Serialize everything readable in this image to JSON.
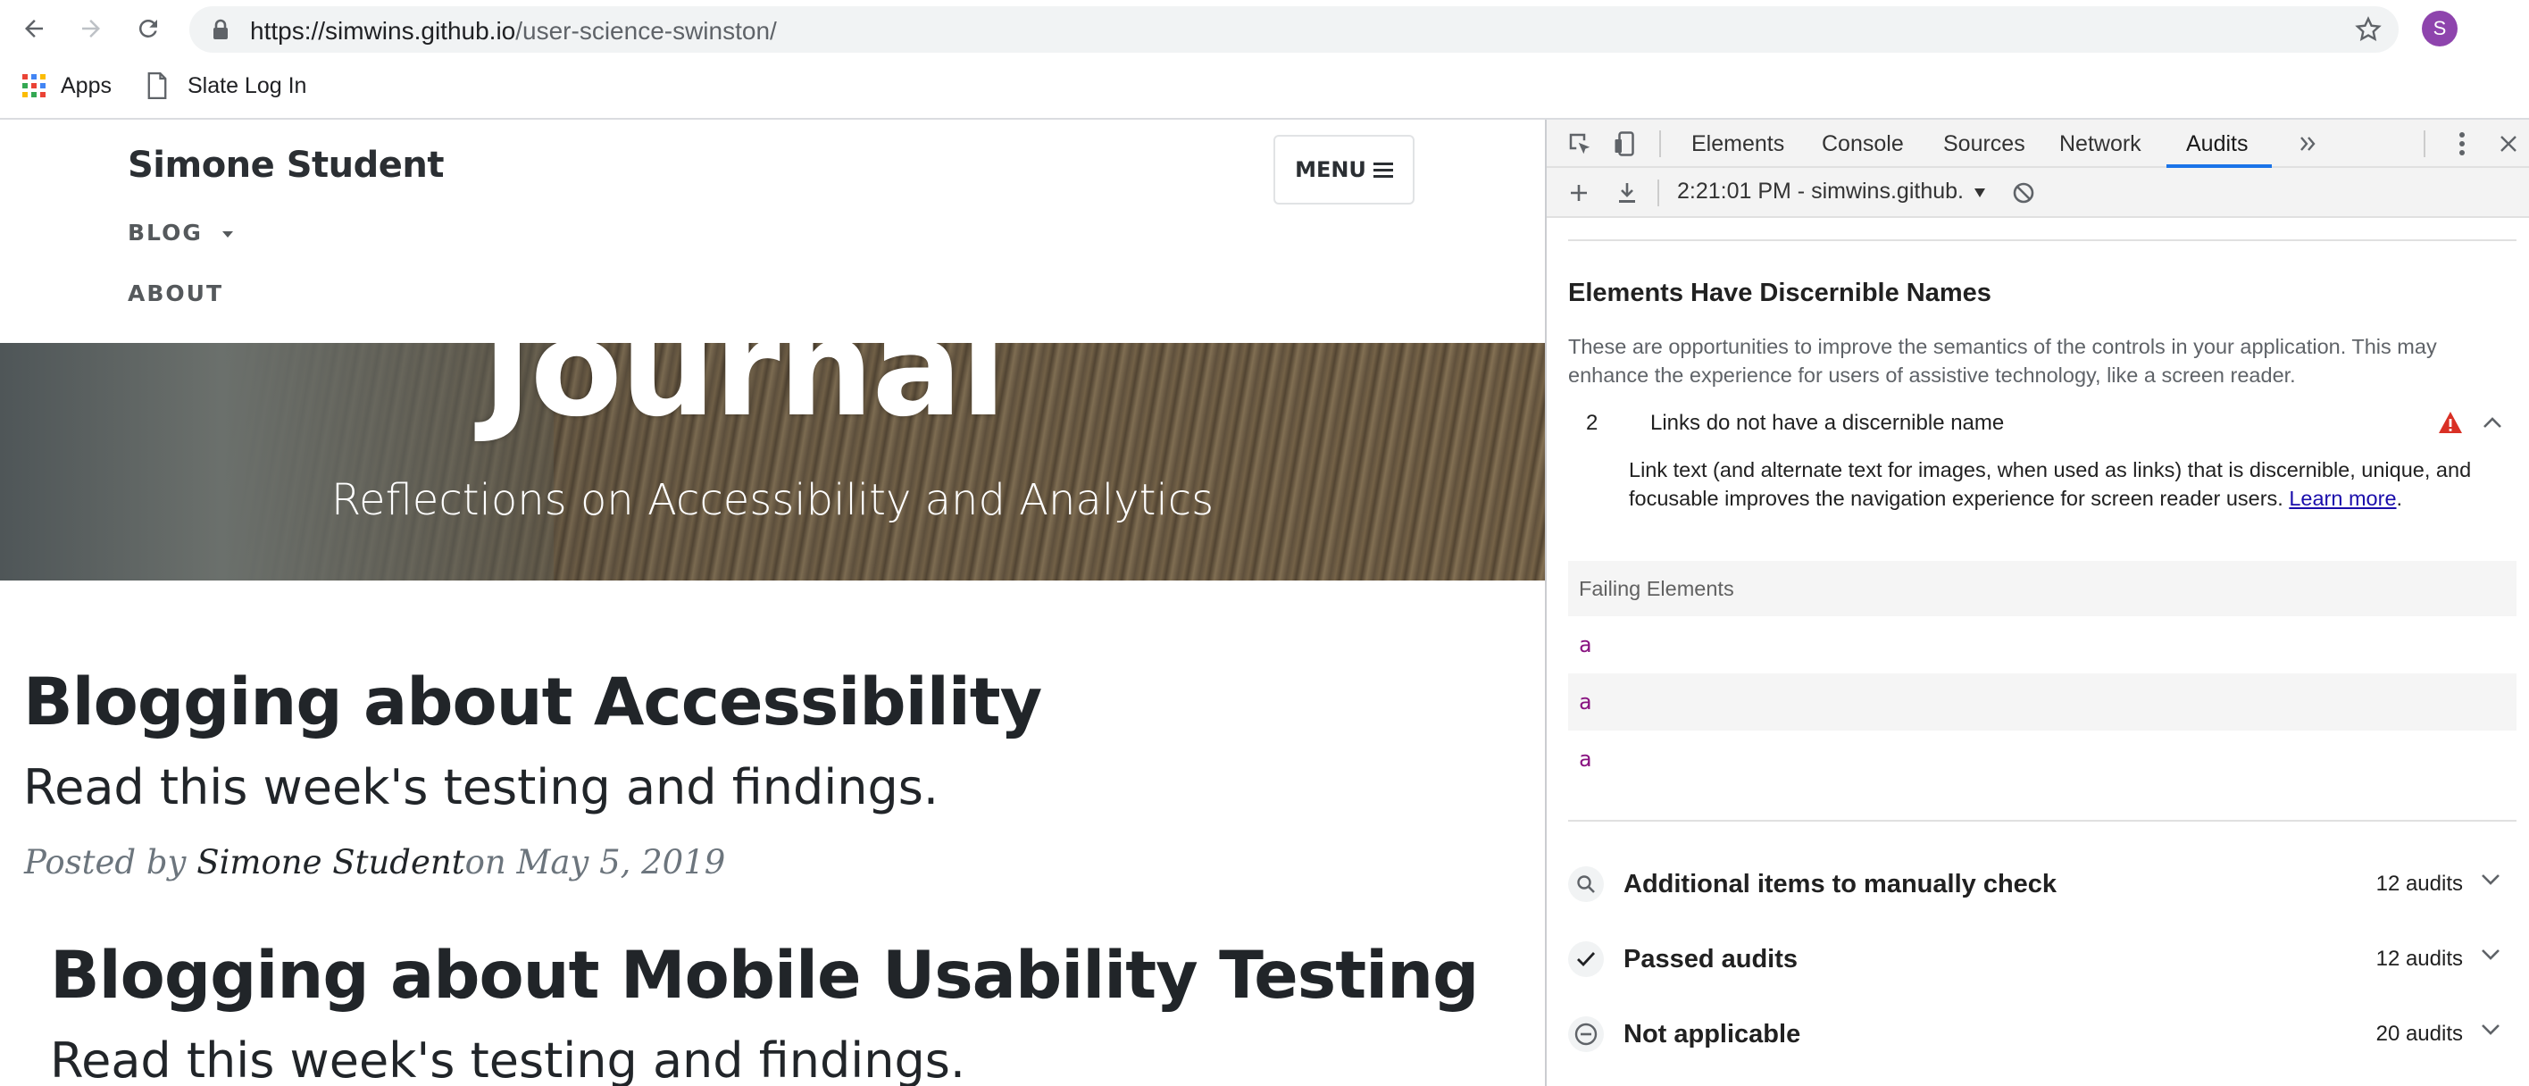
{
  "browser": {
    "url_host": "https://simwins.github.io",
    "url_path": "/user-science-swinston/",
    "profile_initial": "S",
    "bookmarks": [
      {
        "label": "Apps",
        "icon": "apps-grid-icon"
      },
      {
        "label": "Slate Log In",
        "icon": "document-icon"
      }
    ]
  },
  "page": {
    "site_title": "Simone Student",
    "menu_label": "MENU",
    "nav": [
      {
        "label": "BLOG"
      },
      {
        "label": "ABOUT"
      }
    ],
    "hero": {
      "title": "Journal",
      "subtitle": "Reflections on Accessibility and Analytics"
    },
    "posts": [
      {
        "title": "Blogging about Accessibility",
        "subtitle": "Read this week's testing and findings.",
        "meta_prefix": "Posted by ",
        "meta_author": "Simone Student",
        "meta_suffix": "on May 5, 2019"
      },
      {
        "title": "Blogging about Mobile Usability Testing",
        "subtitle": "Read this week's testing and findings."
      }
    ]
  },
  "devtools": {
    "tabs": [
      {
        "label": "Elements"
      },
      {
        "label": "Console"
      },
      {
        "label": "Sources"
      },
      {
        "label": "Network"
      },
      {
        "label": "Audits",
        "active": true
      }
    ],
    "report_label": "2:21:01 PM - simwins.github.io",
    "group": {
      "title": "Elements Have Discernible Names",
      "description": "These are opportunities to improve the semantics of the controls in your application. This may enhance the experience for users of assistive technology, like a screen reader."
    },
    "audit": {
      "count": "2",
      "title": "Links do not have a discernible name",
      "description": "Link text (and alternate text for images, when used as links) that is discernible, unique, and focusable improves the navigation experience for screen reader users. ",
      "learn_more": "Learn more",
      "failing_label": "Failing Elements",
      "failing_elements": [
        "a",
        "a",
        "a"
      ],
      "warning_color": "#d93025"
    },
    "summary_groups": [
      {
        "label": "Additional items to manually check",
        "count": "12 audits",
        "icon": "search-icon"
      },
      {
        "label": "Passed audits",
        "count": "12 audits",
        "icon": "checkmark-icon"
      },
      {
        "label": "Not applicable",
        "count": "20 audits",
        "icon": "minus-circle-icon"
      }
    ]
  }
}
